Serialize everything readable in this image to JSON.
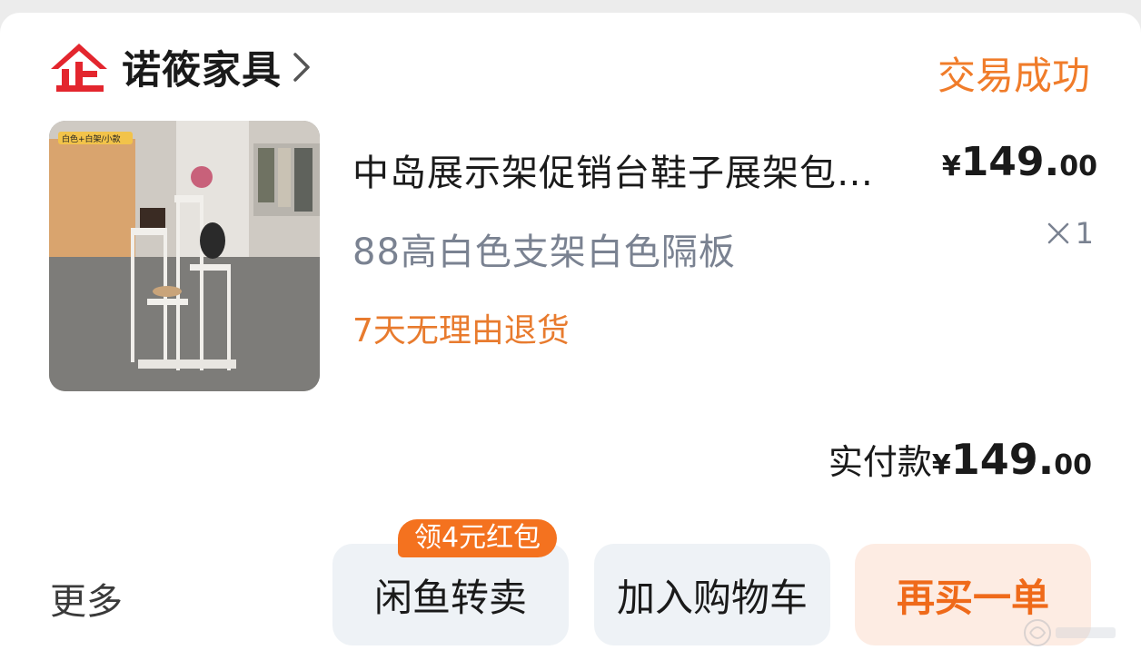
{
  "shop": {
    "logo_glyph": "企",
    "name": "诺筱家具",
    "status": "交易成功"
  },
  "product": {
    "thumbnail_badge": "白色+白架/小款",
    "title": "中岛展示架促销台鞋子展架包…",
    "price": {
      "currency": "¥",
      "integer": "149.",
      "decimal": "00"
    },
    "variant": "88高白色支架白色隔板",
    "quantity": "1",
    "tag": "7天无理由退货"
  },
  "payment": {
    "label": "实付款",
    "currency": "¥",
    "integer": "149.",
    "decimal": "00"
  },
  "actions": {
    "more": "更多",
    "resell": "闲鱼转卖",
    "resell_promo": "领4元红包",
    "add_to_cart": "加入购物车",
    "buy_again": "再买一单"
  },
  "colors": {
    "accent": "#f07c2a",
    "logo_red": "#e3262e",
    "button_bg": "#eef2f6",
    "rebuy_bg": "#fdece3"
  },
  "icons": [
    "shop-logo-icon",
    "chevron-right-icon",
    "multiply-icon"
  ]
}
